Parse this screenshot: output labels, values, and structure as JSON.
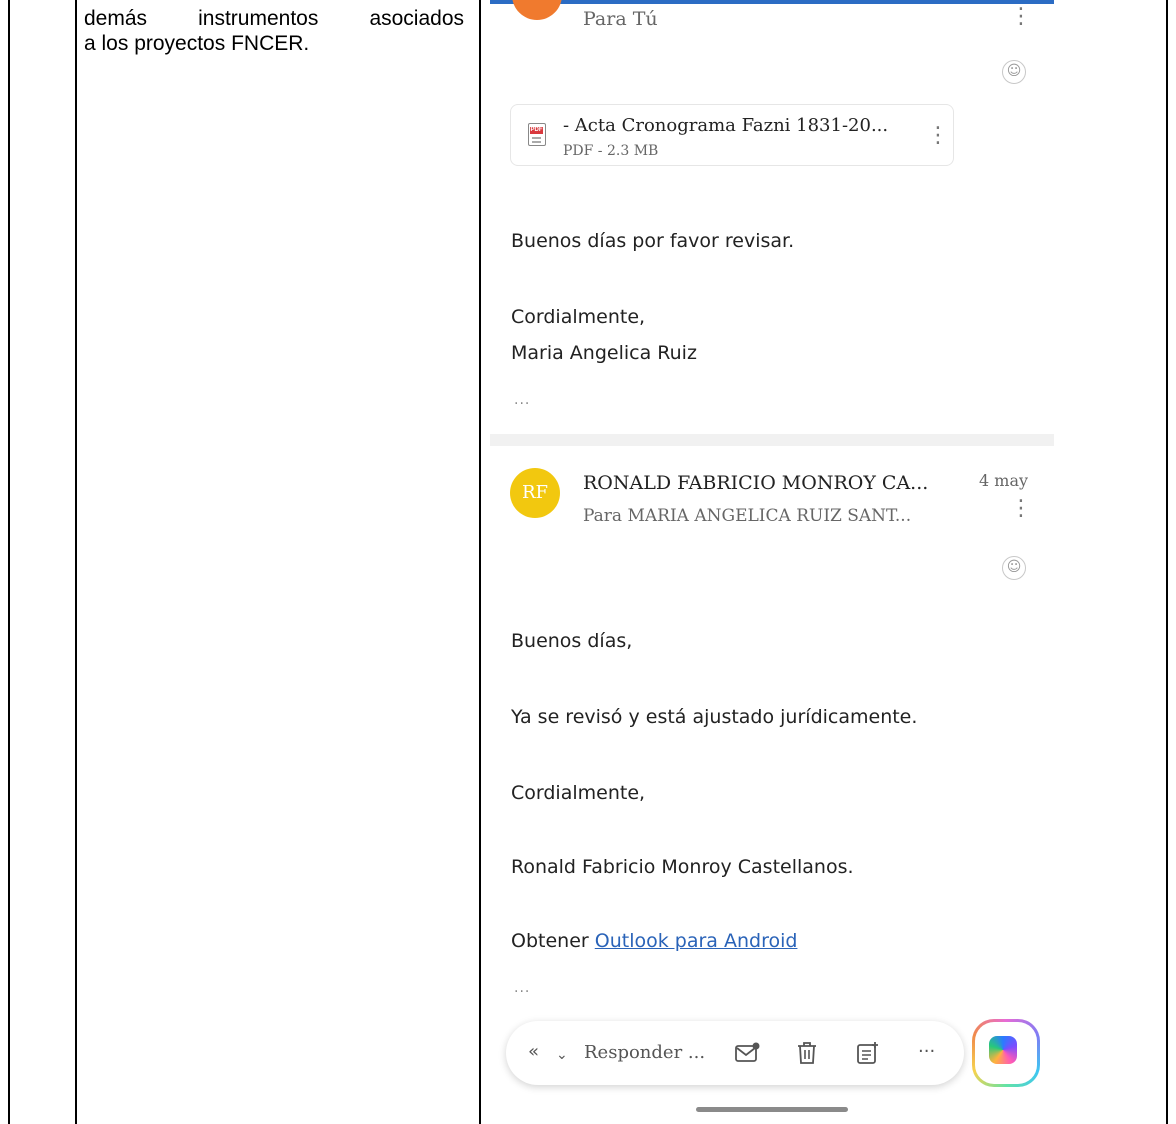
{
  "left_cell": {
    "line1_words": [
      "demás",
      "instrumentos",
      "asociados"
    ],
    "line2": "a los proyectos FNCER."
  },
  "email1": {
    "to": "Para Tú",
    "attachment": {
      "icon_label": "PDF",
      "name": "- Acta Cronograma Fazni 1831-20...",
      "meta": "PDF - 2.3 MB"
    },
    "body": [
      "Buenos días por favor revisar.",
      "Cordialmente,",
      "Maria Angelica Ruiz"
    ],
    "more": "..."
  },
  "email2": {
    "avatar_initials": "RF",
    "sender": "RONALD FABRICIO MONROY CA...",
    "date": "4 may",
    "to": "Para MARIA ANGELICA RUIZ SANT...",
    "body": [
      "Buenos días,",
      "Ya se revisó y está ajustado jurídicamente.",
      "Cordialmente,",
      "Ronald Fabricio Monroy Castellanos."
    ],
    "footer_prefix": "Obtener ",
    "footer_link": "Outlook para Android",
    "more": "..."
  },
  "toolbar": {
    "reply_label": "Responder ...",
    "icons": [
      "reply-all-icon",
      "chevron-down-icon",
      "mark-unread-icon",
      "trash-icon",
      "add-to-list-icon",
      "more-icon",
      "copilot-icon"
    ]
  },
  "colors": {
    "accent": "#2b6cc4",
    "avatar1": "#f07a2e",
    "avatar2": "#f2c80f",
    "link": "#2a63b8"
  }
}
